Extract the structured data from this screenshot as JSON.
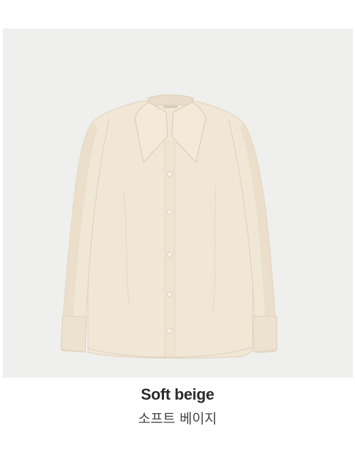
{
  "product": {
    "color_name_en": "Soft beige",
    "color_name_ko": "소프트 베이지",
    "image_alt": "shirt-photo",
    "colors": {
      "panel_background": "#efefed",
      "shirt_fabric": "#f1e7d6",
      "shirt_shadow": "#e4d8c4",
      "button": "#f7f1e6",
      "text_primary": "#2b2b2b",
      "text_secondary": "#444444"
    }
  }
}
